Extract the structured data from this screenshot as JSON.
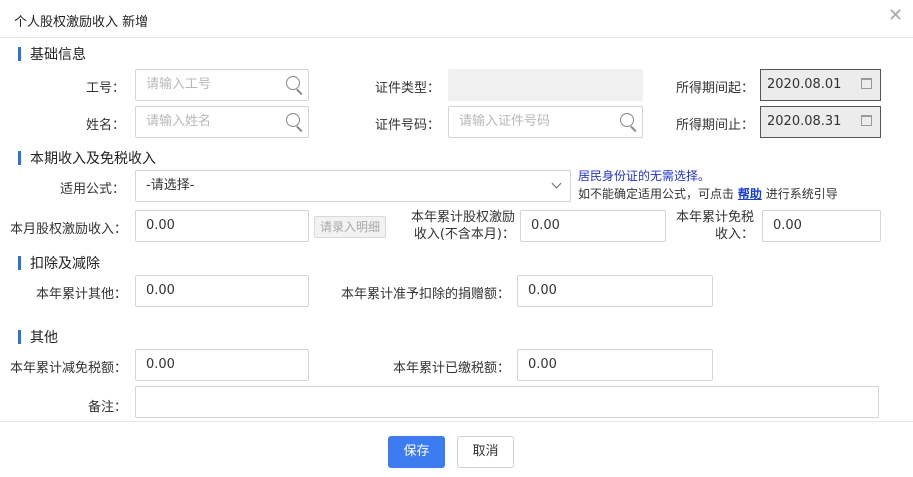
{
  "dialog": {
    "title": "个人股权激励收入 新增",
    "close_glyph": "✕"
  },
  "sections": {
    "basic": "基础信息",
    "income": "本期收入及免税收入",
    "deduction": "扣除及减除",
    "other": "其他"
  },
  "basic": {
    "emp_no_label": "工号：",
    "emp_no_placeholder": "请输入工号",
    "name_label": "姓名：",
    "name_placeholder": "请输入姓名",
    "id_type_label": "证件类型：",
    "id_type_value": "",
    "id_no_label": "证件号码：",
    "id_no_placeholder": "请输入证件号码",
    "period_start_label": "所得期间起：",
    "period_start_value": "2020.08.01",
    "period_end_label": "所得期间止：",
    "period_end_value": "2020.08.31"
  },
  "income": {
    "formula_label": "适用公式：",
    "formula_value": "-请选择-",
    "formula_note_blue": "居民身份证的无需选择。",
    "formula_note_prefix": "如不能确定适用公式，可点击",
    "formula_help_link": "帮助",
    "formula_note_suffix": "进行系统引导",
    "monthly_label": "本月股权激励收入：",
    "monthly_value": "0.00",
    "detail_button": "请录入明细",
    "ytd_label_line1": "本年累计股权激励",
    "ytd_label_line2": "收入(不含本月)：",
    "ytd_value": "0.00",
    "exempt_label_line1": "本年累计免税",
    "exempt_label_line2": "收入：",
    "exempt_value": "0.00"
  },
  "deduction": {
    "other_label": "本年累计其他：",
    "other_value": "0.00",
    "donation_label": "本年累计准予扣除的捐赠额：",
    "donation_value": "0.00"
  },
  "other": {
    "reduction_label": "本年累计减免税额：",
    "reduction_value": "0.00",
    "paid_label": "本年累计已缴税额：",
    "paid_value": "0.00",
    "remark_label": "备注：",
    "remark_value": ""
  },
  "footer": {
    "save": "保存",
    "cancel": "取消"
  },
  "colors": {
    "accent": "#3d7cf0",
    "section_bar": "#2e6fd8",
    "note_blue": "#2233cc"
  }
}
